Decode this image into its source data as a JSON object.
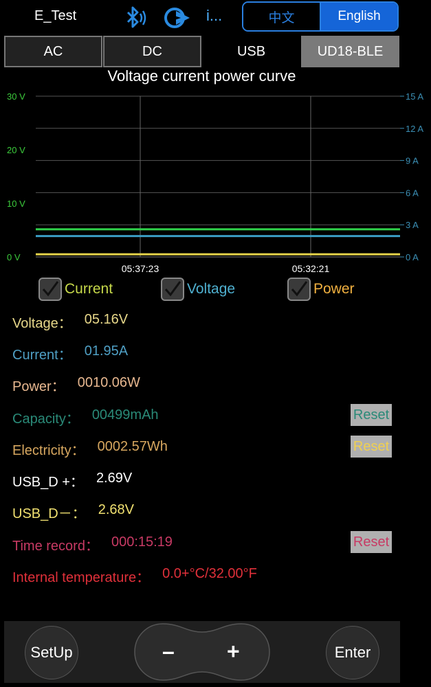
{
  "header": {
    "app_title": "E_Test",
    "info_label": "i...",
    "lang_zh": "中文",
    "lang_en": "English",
    "accent": "#1565d8"
  },
  "tabs": [
    {
      "label": "AC"
    },
    {
      "label": "DC"
    },
    {
      "label": "USB"
    },
    {
      "label": "UD18-BLE",
      "active": true
    }
  ],
  "chart_data": {
    "type": "line",
    "title": "Voltage current power curve",
    "x_ticks": [
      "05:37:23",
      "05:32:21"
    ],
    "y_left": {
      "ticks": [
        "30 V",
        "20 V",
        "10 V",
        "0 V"
      ],
      "range": [
        0,
        30
      ],
      "color": "#3ccb3c"
    },
    "y_right": {
      "ticks": [
        "15 A",
        "12 A",
        "9 A",
        "6 A",
        "3 A",
        "0 A"
      ],
      "range": [
        0,
        15
      ],
      "color": "#3b8fb5"
    },
    "grid": true,
    "series": [
      {
        "name": "Voltage",
        "axis": "left",
        "values": [
          5.16,
          5.16
        ],
        "color": "#2fd04a"
      },
      {
        "name": "Current",
        "axis": "right",
        "values": [
          1.95,
          1.95
        ],
        "color": "#3b9ec5"
      },
      {
        "name": "Power",
        "axis": "left",
        "values": [
          0.5,
          0.5
        ],
        "color": "#e6d44a"
      }
    ]
  },
  "checkboxes": [
    {
      "label": "Current",
      "checked": true,
      "color": "#c6d84a"
    },
    {
      "label": "Voltage",
      "checked": true,
      "color": "#4fb0d0"
    },
    {
      "label": "Power",
      "checked": true,
      "color": "#f0b040"
    }
  ],
  "readings": {
    "voltage": {
      "label": "Voltage：",
      "value": "05.16V",
      "label_color": "#e8d88a",
      "value_color": "#e8d88a"
    },
    "current": {
      "label": "Current：",
      "value": "01.95A",
      "label_color": "#4f9fc4",
      "value_color": "#4f9fc4"
    },
    "power": {
      "label": "Power：",
      "value": "0010.06W",
      "label_color": "#e8b890",
      "value_color": "#e8b890"
    },
    "capacity": {
      "label": "Capacity：",
      "value": "00499mAh",
      "label_color": "#2a8a78",
      "value_color": "#2a8a78"
    },
    "electricity": {
      "label": "Electricity：",
      "value": "0002.57Wh",
      "label_color": "#d8a860",
      "value_color": "#d8a860"
    },
    "usb_dp": {
      "label": "USB_D +：",
      "value": "2.69V",
      "label_color": "#ffffff",
      "value_color": "#ffffff"
    },
    "usb_dm": {
      "label": "USB_D－：",
      "value": "2.68V",
      "label_color": "#f0e070",
      "value_color": "#f0e070"
    },
    "time_record": {
      "label": "Time record：",
      "value": "000:15:19",
      "label_color": "#c83a64",
      "value_color": "#c83a64"
    },
    "temperature": {
      "label": "Internal temperature：",
      "value": "0.0+°C/32.00°F",
      "label_color": "#e0303a",
      "value_color": "#e0303a"
    }
  },
  "reset_buttons": {
    "label": "Reset",
    "capacity_color": "#2a8a78",
    "electricity_color": "#f0d050",
    "time_color": "#c83a64"
  },
  "bottom": {
    "setup_label": "SetUp",
    "minus_label": "–",
    "plus_label": "+",
    "enter_label": "Enter"
  }
}
